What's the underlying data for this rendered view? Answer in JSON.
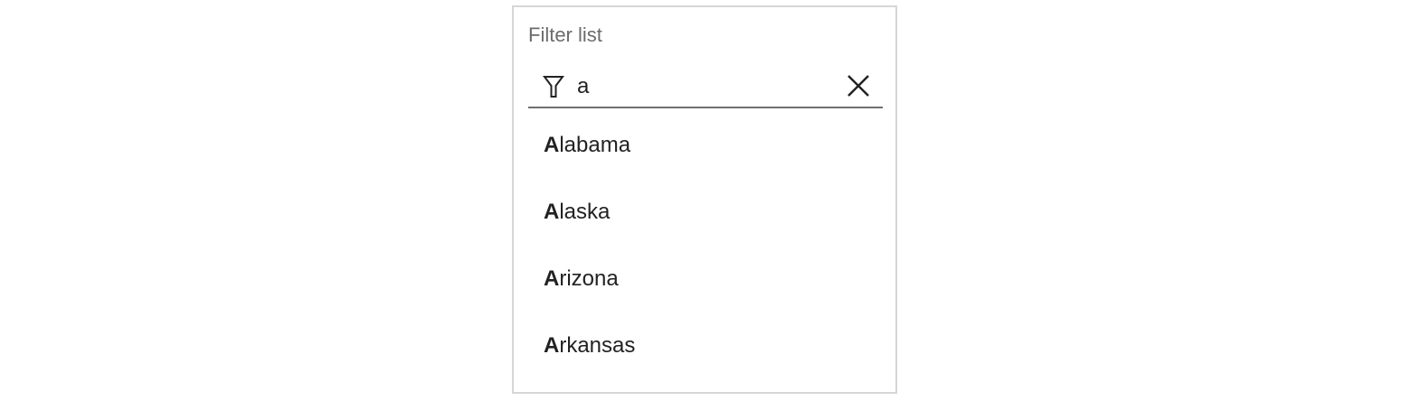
{
  "filter": {
    "label": "Filter list",
    "query": "a",
    "icons": {
      "filter": "filter-funnel-icon",
      "clear": "close-icon"
    }
  },
  "results": [
    {
      "match": "A",
      "rest": "labama"
    },
    {
      "match": "A",
      "rest": "laska"
    },
    {
      "match": "A",
      "rest": "rizona"
    },
    {
      "match": "A",
      "rest": "rkansas"
    }
  ],
  "colors": {
    "panel_border": "#d6d6d6",
    "label_text": "#6b6b6b",
    "input_underline": "#6f6f6f",
    "text": "#222222"
  }
}
